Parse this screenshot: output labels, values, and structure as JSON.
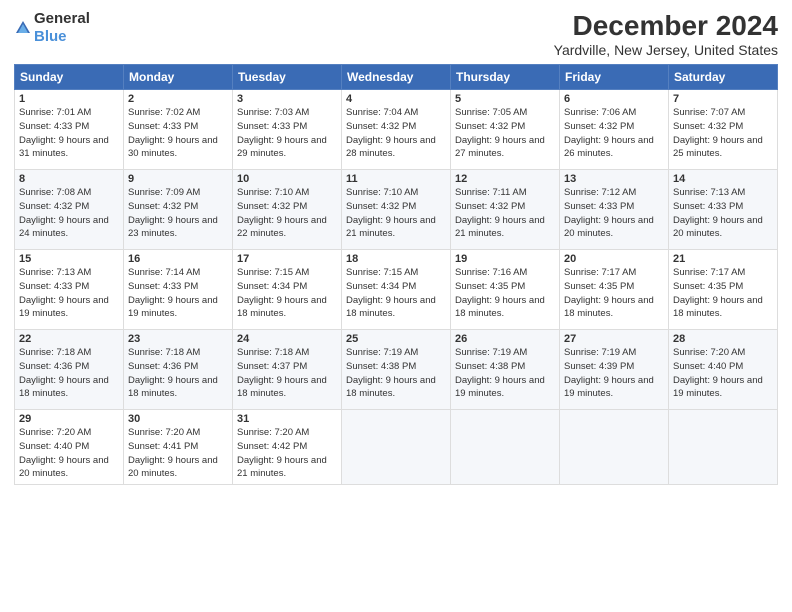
{
  "logo": {
    "general": "General",
    "blue": "Blue"
  },
  "title": "December 2024",
  "subtitle": "Yardville, New Jersey, United States",
  "headers": [
    "Sunday",
    "Monday",
    "Tuesday",
    "Wednesday",
    "Thursday",
    "Friday",
    "Saturday"
  ],
  "weeks": [
    [
      {
        "day": "1",
        "sunrise": "7:01 AM",
        "sunset": "4:33 PM",
        "daylight": "9 hours and 31 minutes."
      },
      {
        "day": "2",
        "sunrise": "7:02 AM",
        "sunset": "4:33 PM",
        "daylight": "9 hours and 30 minutes."
      },
      {
        "day": "3",
        "sunrise": "7:03 AM",
        "sunset": "4:33 PM",
        "daylight": "9 hours and 29 minutes."
      },
      {
        "day": "4",
        "sunrise": "7:04 AM",
        "sunset": "4:32 PM",
        "daylight": "9 hours and 28 minutes."
      },
      {
        "day": "5",
        "sunrise": "7:05 AM",
        "sunset": "4:32 PM",
        "daylight": "9 hours and 27 minutes."
      },
      {
        "day": "6",
        "sunrise": "7:06 AM",
        "sunset": "4:32 PM",
        "daylight": "9 hours and 26 minutes."
      },
      {
        "day": "7",
        "sunrise": "7:07 AM",
        "sunset": "4:32 PM",
        "daylight": "9 hours and 25 minutes."
      }
    ],
    [
      {
        "day": "8",
        "sunrise": "7:08 AM",
        "sunset": "4:32 PM",
        "daylight": "9 hours and 24 minutes."
      },
      {
        "day": "9",
        "sunrise": "7:09 AM",
        "sunset": "4:32 PM",
        "daylight": "9 hours and 23 minutes."
      },
      {
        "day": "10",
        "sunrise": "7:10 AM",
        "sunset": "4:32 PM",
        "daylight": "9 hours and 22 minutes."
      },
      {
        "day": "11",
        "sunrise": "7:10 AM",
        "sunset": "4:32 PM",
        "daylight": "9 hours and 21 minutes."
      },
      {
        "day": "12",
        "sunrise": "7:11 AM",
        "sunset": "4:32 PM",
        "daylight": "9 hours and 21 minutes."
      },
      {
        "day": "13",
        "sunrise": "7:12 AM",
        "sunset": "4:33 PM",
        "daylight": "9 hours and 20 minutes."
      },
      {
        "day": "14",
        "sunrise": "7:13 AM",
        "sunset": "4:33 PM",
        "daylight": "9 hours and 20 minutes."
      }
    ],
    [
      {
        "day": "15",
        "sunrise": "7:13 AM",
        "sunset": "4:33 PM",
        "daylight": "9 hours and 19 minutes."
      },
      {
        "day": "16",
        "sunrise": "7:14 AM",
        "sunset": "4:33 PM",
        "daylight": "9 hours and 19 minutes."
      },
      {
        "day": "17",
        "sunrise": "7:15 AM",
        "sunset": "4:34 PM",
        "daylight": "9 hours and 18 minutes."
      },
      {
        "day": "18",
        "sunrise": "7:15 AM",
        "sunset": "4:34 PM",
        "daylight": "9 hours and 18 minutes."
      },
      {
        "day": "19",
        "sunrise": "7:16 AM",
        "sunset": "4:35 PM",
        "daylight": "9 hours and 18 minutes."
      },
      {
        "day": "20",
        "sunrise": "7:17 AM",
        "sunset": "4:35 PM",
        "daylight": "9 hours and 18 minutes."
      },
      {
        "day": "21",
        "sunrise": "7:17 AM",
        "sunset": "4:35 PM",
        "daylight": "9 hours and 18 minutes."
      }
    ],
    [
      {
        "day": "22",
        "sunrise": "7:18 AM",
        "sunset": "4:36 PM",
        "daylight": "9 hours and 18 minutes."
      },
      {
        "day": "23",
        "sunrise": "7:18 AM",
        "sunset": "4:36 PM",
        "daylight": "9 hours and 18 minutes."
      },
      {
        "day": "24",
        "sunrise": "7:18 AM",
        "sunset": "4:37 PM",
        "daylight": "9 hours and 18 minutes."
      },
      {
        "day": "25",
        "sunrise": "7:19 AM",
        "sunset": "4:38 PM",
        "daylight": "9 hours and 18 minutes."
      },
      {
        "day": "26",
        "sunrise": "7:19 AM",
        "sunset": "4:38 PM",
        "daylight": "9 hours and 19 minutes."
      },
      {
        "day": "27",
        "sunrise": "7:19 AM",
        "sunset": "4:39 PM",
        "daylight": "9 hours and 19 minutes."
      },
      {
        "day": "28",
        "sunrise": "7:20 AM",
        "sunset": "4:40 PM",
        "daylight": "9 hours and 19 minutes."
      }
    ],
    [
      {
        "day": "29",
        "sunrise": "7:20 AM",
        "sunset": "4:40 PM",
        "daylight": "9 hours and 20 minutes."
      },
      {
        "day": "30",
        "sunrise": "7:20 AM",
        "sunset": "4:41 PM",
        "daylight": "9 hours and 20 minutes."
      },
      {
        "day": "31",
        "sunrise": "7:20 AM",
        "sunset": "4:42 PM",
        "daylight": "9 hours and 21 minutes."
      },
      null,
      null,
      null,
      null
    ]
  ]
}
